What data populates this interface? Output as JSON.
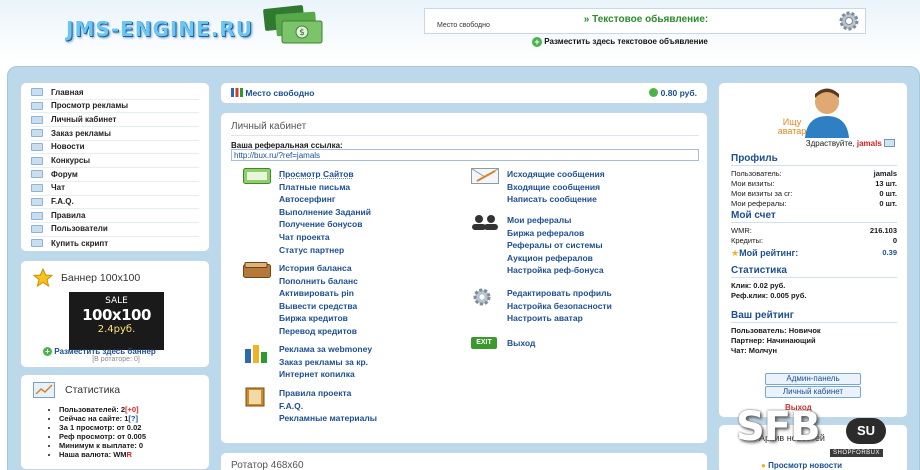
{
  "header": {
    "logo": "JMS-ENGINE.RU",
    "ad_free": "Место свободно",
    "ad_title": "» Текстовое обьявление:",
    "ad_place": "Разместить здесь текстовое объявление"
  },
  "menu": {
    "items": [
      "Главная",
      "Просмотр рекламы",
      "Личный кабинет",
      "Заказ рекламы",
      "Новости",
      "Конкурсы",
      "Форум",
      "Чат",
      "F.A.Q.",
      "Правила",
      "Пользователи",
      "Купить скрипт"
    ]
  },
  "banner": {
    "title": "Баннер 100x100",
    "sale": "SALE",
    "size": "100x100",
    "price": "2.4руб.",
    "place": "Разместить здесь баннер",
    "rotator": "[В ротаторе: 0]"
  },
  "stats": {
    "title": "Статистика",
    "users_label": "Пользователей: ",
    "users_value": "2",
    "users_new": "[+0]",
    "online_label": "Сейчас на сайте: ",
    "online_value": "1",
    "online_extra": "[?]",
    "view_label": "За 1 просмотр: ",
    "view_value": "от 0.02",
    "ref_label": "Реф просмотр: ",
    "ref_value": "от 0.005",
    "min_label": "Минимум к выплате: ",
    "min_value": "0",
    "cur_label": "Наша валюта: ",
    "cur_value": "WM",
    "cur_suffix": "R"
  },
  "center": {
    "free_place": "Место свободно",
    "free_price": "0.80 руб.",
    "cabinet_title": "Личный кабинет",
    "ref_label": "Ваша реферальная ссылка:",
    "ref_link": "http://bux.ru/?ref=jamals",
    "rotator_title": "Ротатор 468x60",
    "left_groups": [
      [
        "Просмотр Сайтов",
        "Платные письма",
        "Автосерфинг",
        "Выполнение Заданий",
        "Получение бонусов",
        "Чат проекта",
        "Статус партнер"
      ],
      [
        "История баланса",
        "Пополнить баланс",
        "Активировать pin",
        "Вывести средства",
        "Биржа кредитов",
        "Перевод кредитов"
      ],
      [
        "Реклама за webmoney",
        "Заказ рекламы за кр.",
        "Интернет копилка"
      ],
      [
        "Правила проекта",
        "F.A.Q.",
        "Рекламные материалы"
      ]
    ],
    "right_groups": [
      [
        "Исходящие сообщения",
        "Входящие сообщения",
        "Написать сообщение"
      ],
      [
        "Мои рефералы",
        "Биржа рефералов",
        "Рефералы от системы",
        "Аукцион рефералов",
        "Настройка реф-бонуса"
      ],
      [
        "Редактировать профиль",
        "Настройка безопасности",
        "Настроить аватар"
      ],
      [
        "Выход"
      ]
    ],
    "exit_badge": "EXIT"
  },
  "profile": {
    "avatar_text": "Ищу аватар",
    "hello": "Здраствуйте, ",
    "username": "jamals",
    "profile_title": "Профиль",
    "user_label": "Пользователь:",
    "user_value": "jamals",
    "visits_label": "Мои визиты:",
    "visits_value": "13 шт.",
    "visits24_label": "Мои визиты за сг:",
    "visits24_value": "0 шт.",
    "refs_label": "Мои рефералы:",
    "refs_value": "0 шт.",
    "account_title": "Мой счет",
    "wmr_label": "WMR:",
    "wmr_value": "216.103",
    "credits_label": "Кредиты:",
    "credits_value": "0",
    "rating_label": "Мой рейтинг:",
    "rating_value": "0.39",
    "stat_title": "Статистика",
    "click_text": "Клик: 0.02 руб.",
    "refclick_text": "Реф.клик: 0.005 руб.",
    "your_rating_title": "Ваш рейтинг",
    "user_rank": "Пользователь: Новичок",
    "partner_rank": "Партнер: Начинающий",
    "chat_rank": "Чат: Молчун",
    "admin_btn": "Админ-панель",
    "cabinet_btn": "Личный кабинет",
    "exit_link": "Выход"
  },
  "news": {
    "title": "Архив новостей",
    "link": "Просмотр новости"
  },
  "watermark": {
    "main": "SFB",
    "su": "SU",
    "sub": "SHOPFORBUX"
  }
}
